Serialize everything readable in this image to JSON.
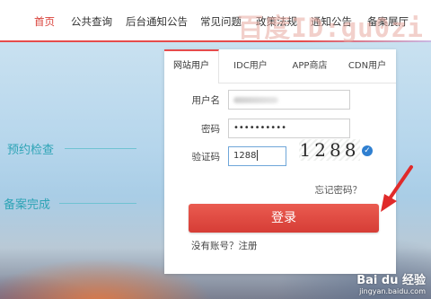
{
  "nav": {
    "items": [
      "首页",
      "公共查询",
      "后台通知公告",
      "常见问题",
      "政策法规",
      "通知公告",
      "备案展厅"
    ],
    "active_index": 0
  },
  "watermark_top": "百度ID:gu0zi",
  "background": {
    "steps": [
      "预约检查",
      "备案完成"
    ]
  },
  "login": {
    "tabs": [
      "网站用户",
      "IDC用户",
      "APP商店",
      "CDN用户"
    ],
    "active_tab": 0,
    "username_label": "用户名",
    "password_label": "密码",
    "password_value": "••••••••••",
    "captcha_label": "验证码",
    "captcha_value": "1288",
    "captcha_image_text": "1288",
    "forgot_link": "忘记密码？",
    "submit_label": "登录",
    "register_link": "没有账号？注册"
  },
  "watermark_bottom": {
    "logo": "Bai du 经验",
    "url": "jingyan.baidu.com"
  },
  "colors": {
    "accent_red": "#e64b4b",
    "button_red": "#d63d36",
    "step_teal": "#2ea4b6",
    "check_blue": "#2f7fd0"
  }
}
